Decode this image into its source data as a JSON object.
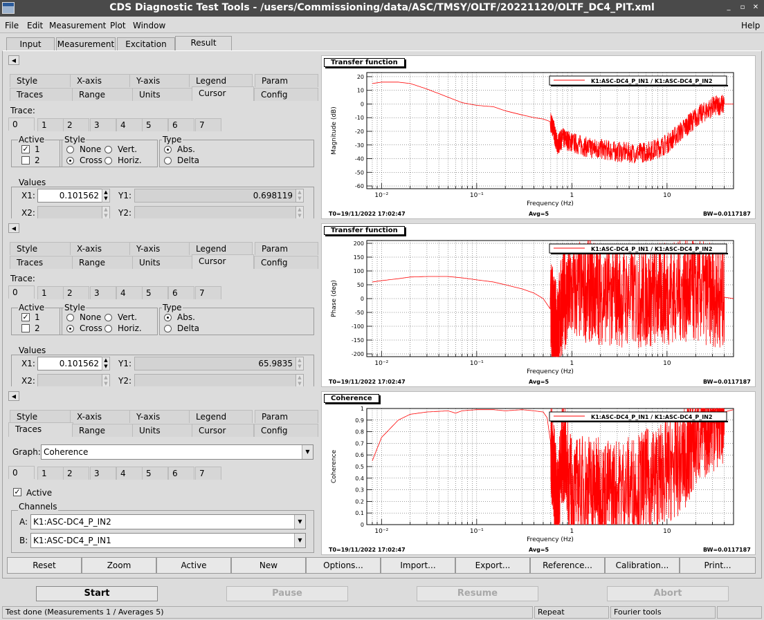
{
  "window": {
    "title": "CDS Diagnostic Test Tools - /users/Commissioning/data/ASC/TMSY/OLTF/20221120/OLTF_DC4_PIT.xml",
    "controls": [
      "_",
      "▫",
      "✕"
    ]
  },
  "menubar": {
    "items": [
      {
        "label": "File"
      },
      {
        "label": "Edit"
      },
      {
        "label": "Measurement"
      },
      {
        "label": "Plot"
      },
      {
        "label": "Window"
      }
    ],
    "help": "Help"
  },
  "main_tabs": [
    "Input",
    "Measurement",
    "Excitation",
    "Result"
  ],
  "option_tabs_row1": [
    "Style",
    "X-axis",
    "Y-axis",
    "Legend",
    "Param"
  ],
  "option_tabs_row2": [
    "Traces",
    "Range",
    "Units",
    "Cursor",
    "Config"
  ],
  "trace_label": "Trace:",
  "trace_tabs": [
    "0",
    "1",
    "2",
    "3",
    "4",
    "5",
    "6",
    "7"
  ],
  "cursor_labels": {
    "active": "Active",
    "style": "Style",
    "type": "Type",
    "one": "1",
    "two": "2",
    "none": "None",
    "cross": "Cross",
    "vert": "Vert.",
    "horiz": "Horiz.",
    "abs": "Abs.",
    "delta": "Delta",
    "values": "Values",
    "x1": "X1:",
    "x2": "X2:",
    "y1": "Y1:",
    "y2": "Y2:"
  },
  "panel1": {
    "x1": "0.101562",
    "y1": "0.698119"
  },
  "panel2": {
    "x1": "0.101562",
    "y1": "65.9835"
  },
  "panel3": {
    "graph_label": "Graph:",
    "graph_value": "Coherence",
    "active_label": "Active",
    "channels_label": "Channels",
    "a_label": "A:",
    "a_value": "K1:ASC-DC4_P_IN2",
    "b_label": "B:",
    "b_value": "K1:ASC-DC4_P_IN1"
  },
  "graphs": [
    {
      "title": "Transfer function",
      "legend": "K1:ASC-DC4_P_IN1 / K1:ASC-DC4_P_IN2",
      "ylabel": "Magnitude (dB)",
      "xlabel": "Frequency (Hz)",
      "t0": "T0=19/11/2022 17:02:47",
      "avg": "Avg=5",
      "bw": "BW=0.0117187"
    },
    {
      "title": "Transfer function",
      "legend": "K1:ASC-DC4_P_IN1 / K1:ASC-DC4_P_IN2",
      "ylabel": "Phase (deg)",
      "xlabel": "Frequency (Hz)",
      "t0": "T0=19/11/2022 17:02:47",
      "avg": "Avg=5",
      "bw": "BW=0.0117187"
    },
    {
      "title": "Coherence",
      "legend": "K1:ASC-DC4_P_IN1 / K1:ASC-DC4_P_IN2",
      "ylabel": "Coherence",
      "xlabel": "Frequency (Hz)",
      "t0": "T0=19/11/2022 17:02:47",
      "avg": "Avg=5",
      "bw": "BW=0.0117187"
    }
  ],
  "chart_data": [
    {
      "type": "line",
      "x_scale": "log",
      "xlim": [
        0.007,
        50
      ],
      "xticks": [
        "10⁻²",
        "10⁻¹",
        "1",
        "10"
      ],
      "ylim": [
        -62,
        23
      ],
      "yticks": [
        20,
        10,
        0,
        -10,
        -20,
        -30,
        -40,
        -50,
        -60
      ],
      "grid": true,
      "legend_position": "top-right",
      "series_color": "#ff0000",
      "x": [
        0.008,
        0.01,
        0.015,
        0.02,
        0.03,
        0.05,
        0.07,
        0.1,
        0.15,
        0.2,
        0.3,
        0.4,
        0.5,
        0.6,
        0.65,
        0.7,
        0.8,
        1,
        1.5,
        2,
        3,
        5,
        7,
        10,
        15,
        20,
        30,
        40,
        50
      ],
      "y": [
        15,
        16,
        16,
        15,
        11,
        5,
        1,
        -1,
        -2,
        -5,
        -8,
        -10,
        -11,
        -13,
        -20,
        -30,
        -25,
        -28,
        -32,
        -33,
        -35,
        -36,
        -34,
        -29,
        -18,
        -10,
        -2,
        0,
        0
      ]
    },
    {
      "type": "line",
      "x_scale": "log",
      "xlim": [
        0.007,
        50
      ],
      "xticks": [
        "10⁻²",
        "10⁻¹",
        "1",
        "10"
      ],
      "ylim": [
        -210,
        210
      ],
      "yticks": [
        200,
        150,
        100,
        50,
        0,
        -50,
        -100,
        -150,
        -200
      ],
      "grid": true,
      "legend_position": "top-right",
      "series_color": "#ff0000",
      "x": [
        0.008,
        0.01,
        0.015,
        0.02,
        0.03,
        0.05,
        0.07,
        0.1,
        0.15,
        0.2,
        0.3,
        0.4,
        0.5,
        0.6,
        0.65,
        0.7,
        0.8,
        1,
        1.5,
        2,
        3,
        5,
        7,
        10,
        15,
        20,
        30,
        40,
        50
      ],
      "y": [
        60,
        65,
        72,
        78,
        80,
        80,
        75,
        68,
        60,
        50,
        35,
        20,
        0,
        -40,
        -100,
        -130,
        0,
        20,
        30,
        20,
        10,
        5,
        10,
        20,
        30,
        25,
        15,
        5,
        0
      ]
    },
    {
      "type": "line",
      "x_scale": "log",
      "xlim": [
        0.007,
        50
      ],
      "xticks": [
        "10⁻²",
        "10⁻¹",
        "1",
        "10"
      ],
      "ylim": [
        0,
        1
      ],
      "yticks": [
        1,
        0.9,
        0.8,
        0.7,
        0.6,
        0.5,
        0.4,
        0.3,
        0.2,
        0.1,
        0
      ],
      "grid": true,
      "legend_position": "top-right",
      "series_color": "#ff0000",
      "x": [
        0.008,
        0.01,
        0.015,
        0.02,
        0.03,
        0.05,
        0.06,
        0.07,
        0.1,
        0.15,
        0.2,
        0.3,
        0.4,
        0.5,
        0.55,
        0.6,
        0.65,
        0.7,
        0.8,
        1,
        1.5,
        2,
        3,
        5,
        7,
        10,
        15,
        20,
        30,
        40,
        50
      ],
      "y": [
        0.55,
        0.75,
        0.9,
        0.95,
        0.97,
        0.98,
        0.96,
        0.98,
        0.99,
        0.99,
        0.98,
        0.99,
        0.98,
        0.97,
        0.92,
        0.7,
        0.45,
        0.1,
        0.65,
        0.3,
        0.35,
        0.3,
        0.3,
        0.35,
        0.4,
        0.45,
        0.55,
        0.75,
        0.9,
        0.97,
        0.99
      ]
    }
  ],
  "plot_buttons": [
    "Reset",
    "Zoom",
    "Active",
    "New",
    "Options...",
    "Import...",
    "Export...",
    "Reference...",
    "Calibration...",
    "Print..."
  ],
  "control_buttons": [
    "Start",
    "Pause",
    "Resume",
    "Abort"
  ],
  "status": {
    "message": "Test done (Measurements 1 / Averages 5)",
    "mode": "Repeat",
    "tools": "Fourier tools"
  },
  "colors": {
    "trace": "#ff0000",
    "titlebar": "#4a4a4a",
    "background": "#dcdcdc"
  }
}
